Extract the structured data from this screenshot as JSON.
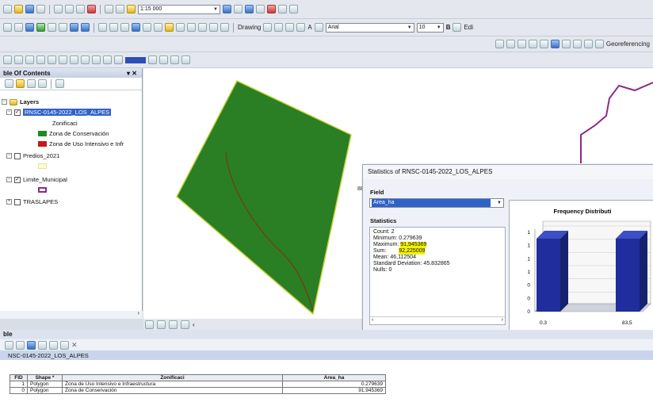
{
  "toolbar": {
    "scale_value": "1:15 000",
    "drawing_label": "Drawing",
    "font_name": "Arial",
    "font_size": "10",
    "bold_label": "B",
    "edit_label": "Edi",
    "georeferencing_label": "Georeferencing"
  },
  "toc": {
    "title": "ble Of Contents",
    "close": "✕",
    "pin": "▾",
    "layers_label": "Layers",
    "items": [
      {
        "label": "RNSC-0145-2022_LOS_ALPES",
        "checked": true,
        "selected": true
      },
      {
        "label": "Zonificaci"
      },
      {
        "label": "Zona de Conservación",
        "color": "#1e8a1e"
      },
      {
        "label": "Zona de Uso Intensivo e Infr",
        "color": "#c21a1a"
      },
      {
        "label": "Predios_2021",
        "checked": false
      },
      {
        "label": "Limite_Municipal",
        "checked": true
      },
      {
        "label": "TRASLAPES",
        "checked": false
      }
    ]
  },
  "dialog": {
    "title": "Statistics of RNSC-0145-2022_LOS_ALPES",
    "field_label": "Field",
    "field_value": "Area_ha",
    "statistics_label": "Statistics",
    "count": "Count:   2",
    "minimum": "Minimum: 0.279639",
    "maximum_label": "Maximum:",
    "maximum_value": "91,945369",
    "sum_label": "Sum:",
    "sum_value": "92,225009",
    "mean": "Mean:    46,112504",
    "std": "Standard Deviation: 45.832865",
    "nulls": "Nulls:   0",
    "chart_title": "Frequency Distributi"
  },
  "chart_data": {
    "type": "bar",
    "title": "Frequency Distributi",
    "categories": [
      "0.3",
      "83.5"
    ],
    "values": [
      1,
      1
    ],
    "y_ticks": [
      "1",
      "1",
      "1",
      "1",
      "0",
      "0",
      "0"
    ],
    "x_ticks": [
      "0.3",
      "83,5"
    ],
    "bar_color": "#1f2e9c"
  },
  "table": {
    "window_title": "ble",
    "tab_label": "NSC-0145-2022_LOS_ALPES",
    "columns": [
      "FID",
      "Shape *",
      "Zonificaci",
      "Area_ha"
    ],
    "rows": [
      [
        "1",
        "Polygon",
        "Zona de Uso Intensivo e Infraestructura",
        "0.279639"
      ],
      [
        "0",
        "Polygon",
        "Zona de Conservación",
        "91.945369"
      ]
    ]
  },
  "colors": {
    "polygon_fill": "#2a7e23",
    "polygon_edge": "#c6d23a",
    "boundary_line": "#8c2a8c"
  }
}
